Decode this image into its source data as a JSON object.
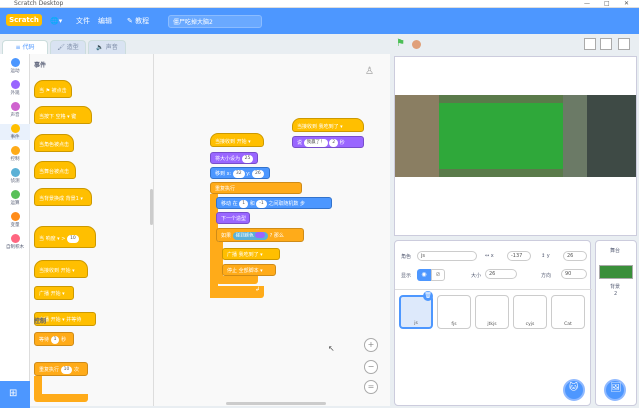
{
  "window": {
    "title": "Scratch Desktop"
  },
  "menu": {
    "logo": "Scratch",
    "items": [
      "文件",
      "编辑",
      "教程"
    ],
    "project_name": "僵尸吃掉大脑2"
  },
  "tabs": [
    "代码",
    "造型",
    "声音"
  ],
  "categories": [
    {
      "label": "运动",
      "color": "#4c97ff"
    },
    {
      "label": "外观",
      "color": "#9966ff"
    },
    {
      "label": "声音",
      "color": "#cf63cf"
    },
    {
      "label": "事件",
      "color": "#ffbf00"
    },
    {
      "label": "控制",
      "color": "#ffab19"
    },
    {
      "label": "侦测",
      "color": "#5cb1d6"
    },
    {
      "label": "运算",
      "color": "#59c059"
    },
    {
      "label": "变量",
      "color": "#ff8c1a"
    },
    {
      "label": "自制积木",
      "color": "#ff6680"
    }
  ],
  "palette": {
    "section_events": "事件",
    "section_control": "控制",
    "blocks": [
      {
        "text": "当 ⚑ 被点击"
      },
      {
        "text": "当按下 空格 ▾ 键"
      },
      {
        "text": "当角色被点击"
      },
      {
        "text": "当舞台被点击"
      },
      {
        "text": "当背景换成 背景1 ▾"
      },
      {
        "text": "当 响度 ▾ >",
        "val": "10"
      },
      {
        "text": "当接收到 开始 ▾"
      },
      {
        "text": "广播 开始 ▾"
      },
      {
        "text": "广播 开始 ▾ 并等待"
      },
      {
        "text": "等待",
        "val": "1",
        "suffix": "秒"
      },
      {
        "text": "重复执行",
        "val": "10",
        "suffix": "次"
      }
    ]
  },
  "script1": {
    "hat": "当接收到 开始 ▾",
    "size": "将大小设为",
    "size_val": "25",
    "goto": "移到 x:",
    "goto_x": "32",
    "goto_y_lbl": "y:",
    "goto_y": "26",
    "forever": "重复执行",
    "glide": "移动",
    "glide_a": "在",
    "glide_1": "1",
    "glide_and": "和",
    "glide_2": "-1",
    "glide_rand": "之间取随机数",
    "glide_steps": "步",
    "next_costume": "下一个造型",
    "if": "如果",
    "touching": "碰到颜色",
    "then": "? 那么",
    "broadcast": "广播 我吃到了 ▾",
    "stop": "停止 全部脚本 ▾"
  },
  "script2": {
    "hat": "当接收到 我吃到了 ▾",
    "say": "说",
    "say_text": "我赢了！",
    "say_val": "2",
    "say_sec": "秒"
  },
  "sprite_info": {
    "label_sprite": "角色",
    "sprite_name": "js",
    "label_x": "x",
    "x": "-137",
    "label_y": "y",
    "y": "26",
    "label_show": "显示",
    "label_size": "大小",
    "size": "26",
    "label_dir": "方向",
    "direction": "90"
  },
  "sprites": [
    "js",
    "fjs",
    "jtkjs",
    "cyjs",
    "Cat"
  ],
  "stage_pane": {
    "title": "舞台",
    "label": "背景",
    "count": "2"
  }
}
